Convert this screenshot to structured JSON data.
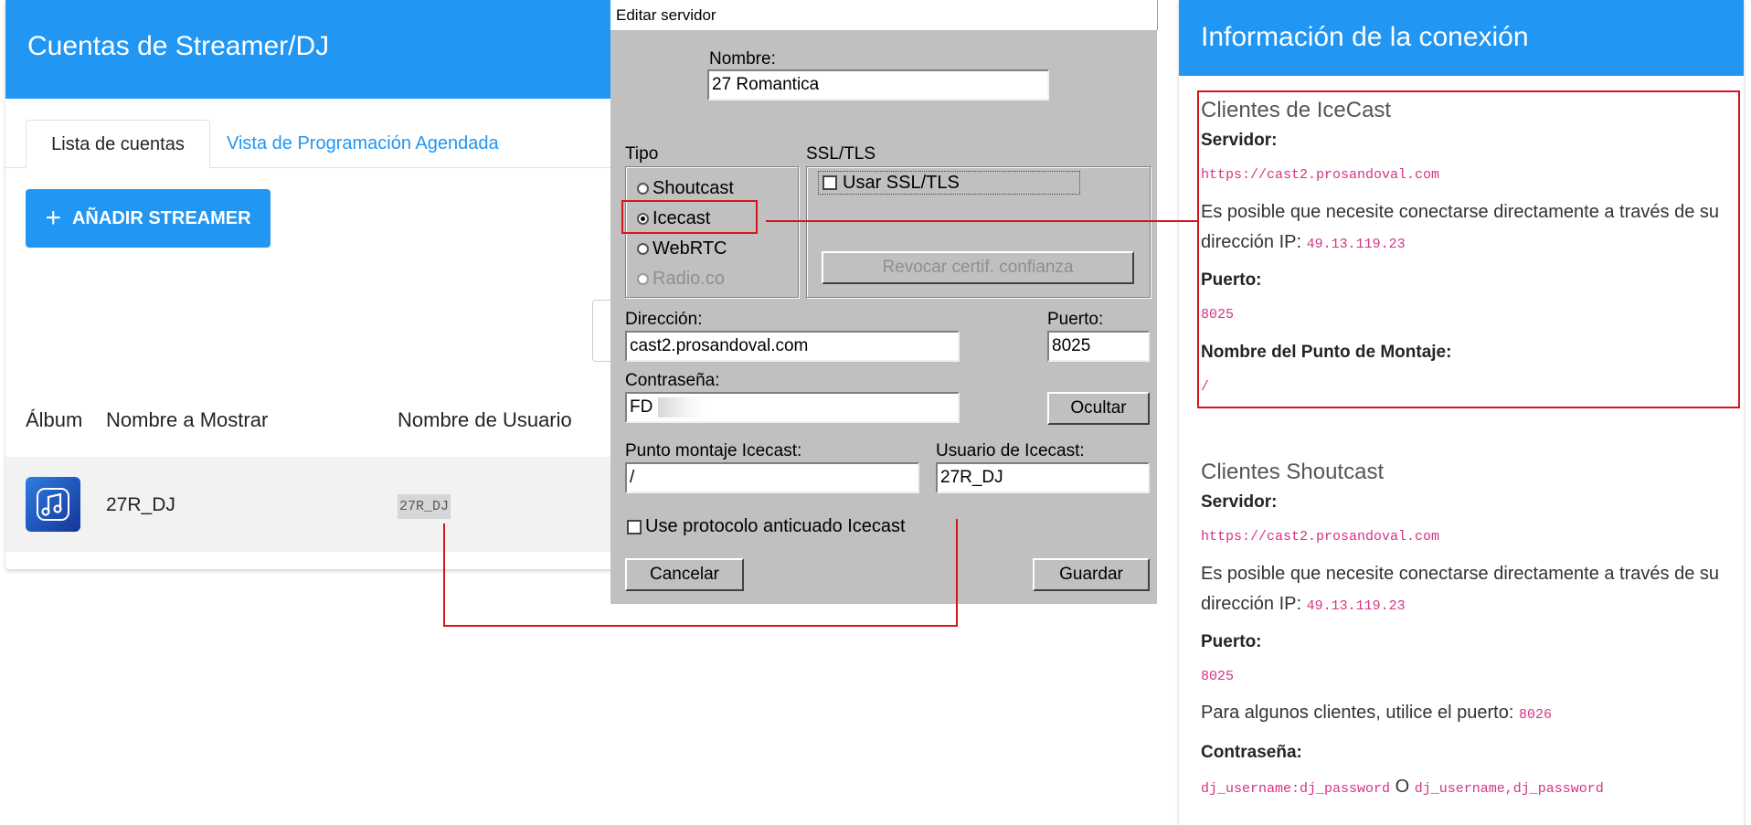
{
  "left": {
    "title": "Cuentas de Streamer/DJ",
    "tabs": [
      "Lista de cuentas",
      "Vista de Programación Agendada"
    ],
    "add_button": "AÑADIR STREAMER",
    "columns": [
      "Álbum",
      "Nombre a Mostrar",
      "Nombre de Usuario"
    ],
    "row": {
      "display_name": "27R_DJ",
      "username": "27R_DJ",
      "album_icon": "music-note-icon"
    }
  },
  "dialog": {
    "title": "Editar servidor",
    "name_label": "Nombre:",
    "name_value": "27 Romantica",
    "tipo_label": "Tipo",
    "types": [
      "Shoutcast",
      "Icecast",
      "WebRTC",
      "Radio.co"
    ],
    "selected_type": "Icecast",
    "ssl_label": "SSL/TLS",
    "ssl_checkbox": "Usar SSL/TLS",
    "revoke_button": "Revocar certif. confianza",
    "address_label": "Dirección:",
    "address_value": "cast2.prosandoval.com",
    "port_label": "Puerto:",
    "port_value": "8025",
    "password_label": "Contraseña:",
    "password_value": "FD",
    "hide_button": "Ocultar",
    "mount_label": "Punto montaje Icecast:",
    "mount_value": "/",
    "user_label": "Usuario de Icecast:",
    "user_value": "27R_DJ",
    "legacy_checkbox": "Use protocolo anticuado Icecast",
    "cancel_button": "Cancelar",
    "save_button": "Guardar"
  },
  "right": {
    "title": "Información de la conexión",
    "icecast": {
      "heading": "Clientes de IceCast",
      "server_label": "Servidor:",
      "server_value": "https://cast2.prosandoval.com",
      "ip_text": "Es posible que necesite conectarse directamente a través de su dirección IP:",
      "ip_value": "49.13.119.23",
      "port_label": "Puerto:",
      "port_value": "8025",
      "mount_label": "Nombre del Punto de Montaje:",
      "mount_value": "/"
    },
    "shoutcast": {
      "heading": "Clientes Shoutcast",
      "server_label": "Servidor:",
      "server_value": "https://cast2.prosandoval.com",
      "ip_text": "Es posible que necesite conectarse directamente a través de su dirección IP:",
      "ip_value": "49.13.119.23",
      "port_label": "Puerto:",
      "port_value": "8025",
      "alt_port_text": "Para algunos clientes, utilice el puerto:",
      "alt_port_value": "8026",
      "password_label": "Contraseña:",
      "password_value_1": "dj_username:dj_password",
      "password_or": "O",
      "password_value_2": "dj_username,dj_password"
    }
  },
  "colors": {
    "accent": "#2196f3",
    "annotation": "#d8141b",
    "code": "#d63384"
  }
}
